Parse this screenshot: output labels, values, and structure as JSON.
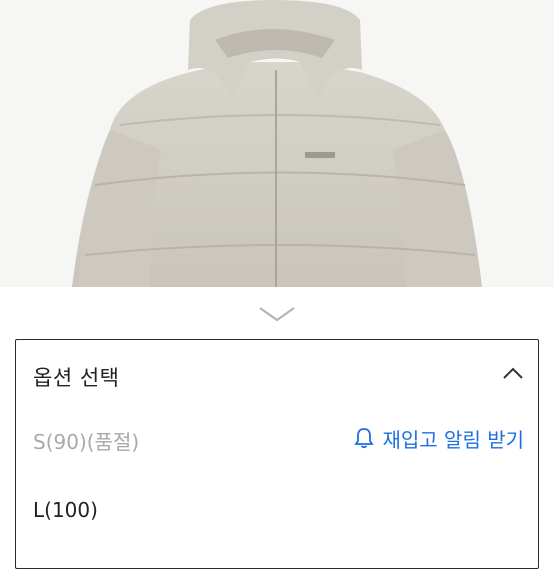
{
  "product": {
    "image_name": "beige hooded puffer jacket"
  },
  "options": {
    "title": "옵션 선택",
    "items": [
      {
        "label": "S(90)(품절)",
        "soldout": true,
        "action_label": "재입고 알림 받기"
      },
      {
        "label": "L(100)",
        "soldout": false
      }
    ]
  },
  "colors": {
    "accent": "#1f6fe0",
    "soldout_text": "#a9a9a9",
    "border": "#2b2b2b"
  }
}
